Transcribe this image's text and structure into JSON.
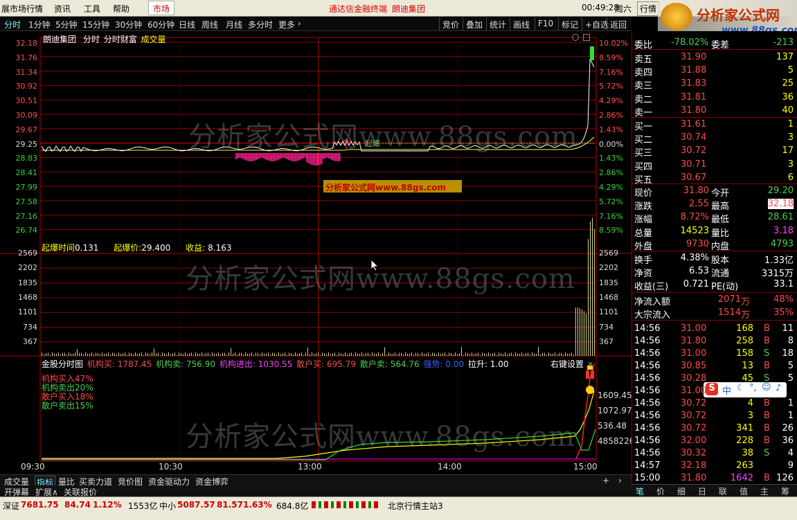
{
  "menubar": {
    "items": [
      "展市场行情",
      "资讯",
      "工具",
      "帮助",
      "市场"
    ],
    "center_title": "通达信金融终端",
    "stock_title": "朗迪集团",
    "clock": "00:49:28",
    "weekday": "周六",
    "right_btn": "行情",
    "logo_text": "分析家公式网",
    "logo_url": "www.88gs.com"
  },
  "toolbar": {
    "periods": [
      "分时",
      "1分钟",
      "5分钟",
      "15分钟",
      "30分钟",
      "60分钟",
      "日线",
      "周线",
      "月线",
      "多分时",
      "更多"
    ],
    "right_buttons": [
      "竞价",
      "叠加",
      "统计",
      "画线",
      "F10",
      "标记",
      "+自选",
      "返回"
    ]
  },
  "chart_header": {
    "name": "朗迪集团",
    "mode": "分时",
    "indicator": "分时财富",
    "vol_label": "成交量"
  },
  "price_axis": {
    "left": [
      "32.18",
      "31.76",
      "31.34",
      "30.92",
      "30.51",
      "30.09",
      "29.67",
      "29.25",
      "28.83",
      "28.41",
      "27.99",
      "27.58",
      "27.16",
      "26.74"
    ],
    "right": [
      "10.02%",
      "8.59%",
      "7.16%",
      "5.72%",
      "4.29%",
      "2.86%",
      "1.43%",
      "0.00%",
      "1.43%",
      "2.86%",
      "4.29%",
      "5.72%",
      "7.16%",
      "8.59%"
    ]
  },
  "annotation": {
    "label": "起爆"
  },
  "blast_info": {
    "time_label": "起爆时间",
    "time_value": "0.131",
    "price_label": "起爆价:",
    "price_value": "29.400",
    "profit_label": "收益:",
    "profit_value": "8.163"
  },
  "volume_axis": [
    "2569",
    "2202",
    "1835",
    "1468",
    "1101",
    "734",
    "367"
  ],
  "fund_header": {
    "title": "金股分时图",
    "inst_buy": "机构买: 1787.45",
    "inst_sell": "机构卖: 756.90",
    "inst_net": "机构进出: 1030.55",
    "retail_buy": "散户买: 695.79",
    "retail_sell": "散户卖: 564.76",
    "strong": "强势: 0.00",
    "pull": "拉升: 1.00",
    "settings": "右键设置"
  },
  "fund_legend": [
    "机构买入47%",
    "机构卖出20%",
    "散户买入18%",
    "散户卖出15%"
  ],
  "fund_axis": [
    "1609.45",
    "1072.97",
    "536.48",
    "4858226"
  ],
  "time_axis": [
    "09:30",
    "10:30",
    "13:00",
    "14:00",
    "15:00"
  ],
  "bottom_tabs": [
    "成交量",
    "指标",
    "量比",
    "买卖力道",
    "竞价图",
    "资金驱动力",
    "资金博弈"
  ],
  "bottom_tabs2": [
    "开弹幕",
    "扩展∧",
    "关联报价"
  ],
  "watermark": "分析家公式网www.88gs.com",
  "watermark_small": "分析家公式网www.88gs.com",
  "quote": {
    "weibi_label": "委比",
    "weibi": "-78.02%",
    "weicha_label": "委差",
    "weicha": "-213",
    "asks": [
      {
        "label": "卖五",
        "price": "31.90",
        "vol": "137"
      },
      {
        "label": "卖四",
        "price": "31.88",
        "vol": "5"
      },
      {
        "label": "卖三",
        "price": "31.83",
        "vol": "25"
      },
      {
        "label": "卖二",
        "price": "31.81",
        "vol": "36"
      },
      {
        "label": "卖一",
        "price": "31.80",
        "vol": "40"
      }
    ],
    "bids": [
      {
        "label": "买一",
        "price": "31.61",
        "vol": "1"
      },
      {
        "label": "买二",
        "price": "30.74",
        "vol": "3"
      },
      {
        "label": "买三",
        "price": "30.72",
        "vol": "17"
      },
      {
        "label": "买四",
        "price": "30.71",
        "vol": "3"
      },
      {
        "label": "买五",
        "price": "30.67",
        "vol": "6"
      }
    ],
    "stats": [
      {
        "l1": "现价",
        "v1": "31.80",
        "c1": "red",
        "l2": "今开",
        "v2": "29.20",
        "c2": "grn"
      },
      {
        "l1": "涨跌",
        "v1": "2.55",
        "c1": "red",
        "l2": "最高",
        "v2": "32.18",
        "c2": "red"
      },
      {
        "l1": "涨幅",
        "v1": "8.72%",
        "c1": "red",
        "l2": "最低",
        "v2": "28.61",
        "c2": "grn"
      },
      {
        "l1": "总量",
        "v1": "14523",
        "c1": "yel",
        "l2": "量比",
        "v2": "3.18",
        "c2": "mag"
      },
      {
        "l1": "外盘",
        "v1": "9730",
        "c1": "red",
        "l2": "内盘",
        "v2": "4793",
        "c2": "grn"
      }
    ],
    "fin": [
      {
        "l1": "换手",
        "v1": "4.38%",
        "l2": "股本",
        "v2": "1.33亿"
      },
      {
        "l1": "净资",
        "v1": "6.53",
        "l2": "流通",
        "v2": "3315万"
      },
      {
        "l1": "收益(三)",
        "v1": "0.721",
        "l2": "PE(动)",
        "v2": "33.1"
      }
    ],
    "flow": [
      {
        "label": "净流入额",
        "value": "2071",
        "unit": "万",
        "pct": "48%"
      },
      {
        "label": "大宗流入",
        "value": "1514",
        "unit": "万",
        "pct": "35%"
      }
    ],
    "ticks": [
      {
        "t": "14:56",
        "p": "31.00",
        "pc": "red",
        "v": "168",
        "vc": "yel",
        "s": "B",
        "n": "11"
      },
      {
        "t": "14:56",
        "p": "31.80",
        "pc": "red",
        "v": "258",
        "vc": "yel",
        "s": "B",
        "n": "8"
      },
      {
        "t": "14:56",
        "p": "31.00",
        "pc": "red",
        "v": "158",
        "vc": "yel",
        "s": "S",
        "n": "18"
      },
      {
        "t": "14:56",
        "p": "30.85",
        "pc": "red",
        "v": "13",
        "vc": "yel",
        "s": "B",
        "n": "5"
      },
      {
        "t": "14:56",
        "p": "30.28",
        "pc": "red",
        "v": "45",
        "vc": "yel",
        "s": "S",
        "n": "5"
      },
      {
        "t": "14:56",
        "p": "31.00",
        "pc": "red",
        "v": "",
        "vc": "yel",
        "s": "",
        "n": ""
      },
      {
        "t": "14:56",
        "p": "30.72",
        "pc": "red",
        "v": "4",
        "vc": "yel",
        "s": "B",
        "n": "1"
      },
      {
        "t": "14:56",
        "p": "30.72",
        "pc": "red",
        "v": "3",
        "vc": "yel",
        "s": "B",
        "n": "1"
      },
      {
        "t": "14:56",
        "p": "30.72",
        "pc": "red",
        "v": "341",
        "vc": "yel",
        "s": "B",
        "n": "26"
      },
      {
        "t": "14:56",
        "p": "32.00",
        "pc": "red",
        "v": "228",
        "vc": "yel",
        "s": "B",
        "n": "36"
      },
      {
        "t": "14:56",
        "p": "30.32",
        "pc": "red",
        "v": "38",
        "vc": "yel",
        "s": "S",
        "n": "4"
      },
      {
        "t": "14:57",
        "p": "32.18",
        "pc": "red",
        "v": "263",
        "vc": "yel",
        "s": "",
        "n": "9"
      },
      {
        "t": "15:00",
        "p": "31.80",
        "pc": "red",
        "v": "1642",
        "vc": "mag",
        "s": "B",
        "n": "126"
      }
    ],
    "ime": "中"
  },
  "right_tabs": [
    "笔",
    "价",
    "细",
    "日",
    "联",
    "值",
    "主",
    "筹"
  ],
  "status": {
    "sz_label": "深证",
    "sz_val": "7681.75",
    "sz_chg": "84.74",
    "sz_pct": "1.12%",
    "sz_amt": "1553亿",
    "zx_label": "中小",
    "zx_val": "5087.57",
    "zx_chg": "81.57",
    "zx_pct": "1.63%",
    "zx_amt": "684.8亿",
    "server": "北京行情主站3"
  }
}
